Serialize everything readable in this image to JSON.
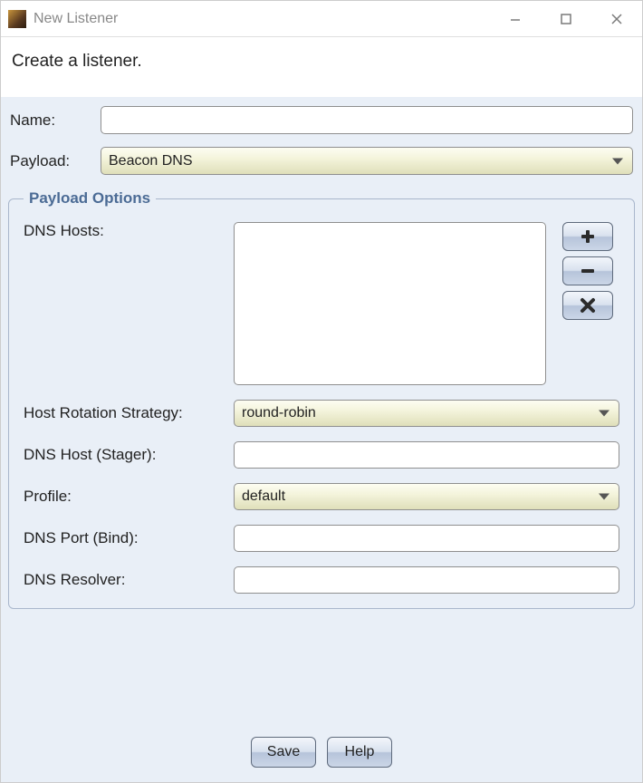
{
  "window": {
    "title": "New Listener"
  },
  "banner": "Create a listener.",
  "form": {
    "name_label": "Name:",
    "name_value": "",
    "payload_label": "Payload:",
    "payload_value": "Beacon DNS"
  },
  "payload_options": {
    "legend": "Payload Options",
    "dns_hosts_label": "DNS Hosts:",
    "dns_hosts_value": "",
    "host_rotation_label": "Host Rotation Strategy:",
    "host_rotation_value": "round-robin",
    "dns_host_stager_label": "DNS Host (Stager):",
    "dns_host_stager_value": "",
    "profile_label": "Profile:",
    "profile_value": "default",
    "dns_port_bind_label": "DNS Port (Bind):",
    "dns_port_bind_value": "",
    "dns_resolver_label": "DNS Resolver:",
    "dns_resolver_value": ""
  },
  "buttons": {
    "save": "Save",
    "help": "Help"
  }
}
